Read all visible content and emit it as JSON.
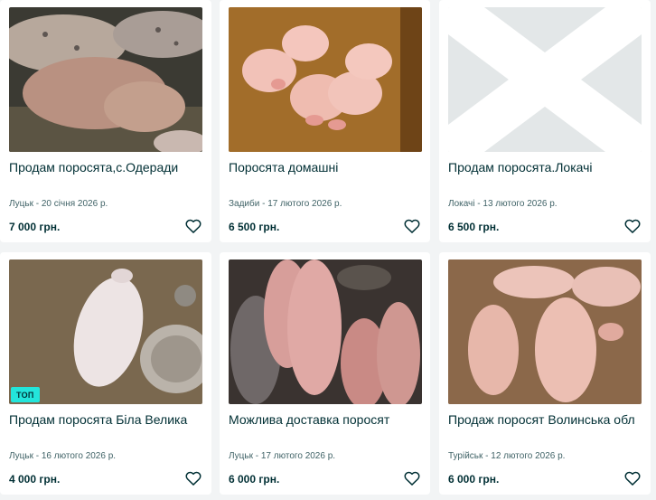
{
  "listings": [
    {
      "title": "Продам поросята,с.Одеради",
      "meta": "Луцьк - 20 січня 2026 р.",
      "price": "7 000 грн.",
      "image": "spotted-pigs-photo",
      "badge": ""
    },
    {
      "title": "Поросята домашні",
      "meta": "Задиби - 17 лютого 2026 р.",
      "price": "6 500 грн.",
      "image": "piglets-on-straw-photo",
      "badge": ""
    },
    {
      "title": "Продам поросята.Локачі",
      "meta": "Локачі - 13 лютого 2026 р.",
      "price": "6 500 грн.",
      "image": "no-photo-placeholder",
      "badge": ""
    },
    {
      "title": "Продам поросята Біла Велика",
      "meta": "Луцьк - 16 лютого 2026 р.",
      "price": "4 000 грн.",
      "image": "white-piglet-photo",
      "badge": "ТОП"
    },
    {
      "title": "Можлива доставка поросят",
      "meta": "Луцьк - 17 лютого 2026 р.",
      "price": "6 000 грн.",
      "image": "pigs-in-pen-photo",
      "badge": ""
    },
    {
      "title": "Продаж поросят Волинська обл",
      "meta": "Турійськ - 12 лютого 2026 р.",
      "price": "6 000 грн.",
      "image": "pink-pigs-photo",
      "badge": ""
    }
  ],
  "colors": {
    "background": "#f2f4f5",
    "card": "#ffffff",
    "text": "#002f34",
    "meta_text": "#406367",
    "top_badge": "#23e5db",
    "placeholder": "#e3e7e8"
  },
  "icons": {
    "favorite": "heart-outline-icon"
  }
}
